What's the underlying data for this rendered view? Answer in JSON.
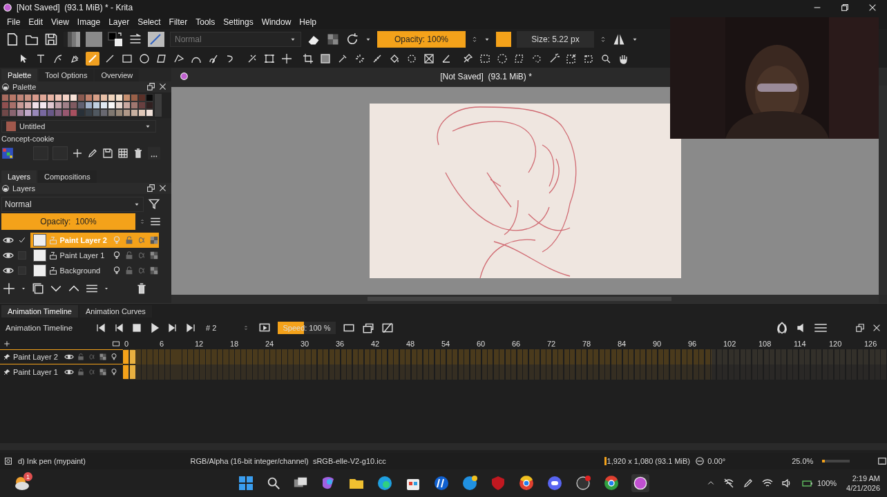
{
  "window": {
    "title": "[Not Saved]  (93.1 MiB) * - Krita"
  },
  "menu": [
    "File",
    "Edit",
    "View",
    "Image",
    "Layer",
    "Select",
    "Filter",
    "Tools",
    "Settings",
    "Window",
    "Help"
  ],
  "toolbar": {
    "blend_mode": "Normal",
    "opacity": {
      "label": "Opacity: 100%",
      "level": 1
    },
    "size": {
      "label": "Size: 5.22 px"
    },
    "foreground": {
      "color": "#f4a21a"
    }
  },
  "tools": [
    {
      "selected": false
    },
    {
      "selected": false
    },
    {
      "selected": false
    },
    {
      "selected": false
    },
    {
      "selected": true
    },
    {
      "selected": false
    },
    {
      "selected": false
    },
    {
      "selected": false
    },
    {
      "selected": false
    },
    {
      "selected": false
    },
    {
      "selected": false
    },
    {
      "selected": false
    },
    {
      "selected": false
    },
    {
      "selected": false
    },
    {
      "selected": false
    },
    {
      "selected": false
    },
    {
      "selected": false
    },
    {
      "selected": false
    },
    {
      "selected": false
    },
    {
      "selected": false
    },
    {
      "selected": false
    },
    {
      "selected": false
    },
    {
      "selected": false
    },
    {
      "selected": false
    },
    {
      "selected": false
    },
    {
      "selected": false
    },
    {
      "selected": false
    },
    {
      "selected": false
    },
    {
      "selected": false
    },
    {
      "selected": false
    },
    {
      "selected": false
    },
    {
      "selected": false
    },
    {
      "selected": false
    },
    {
      "selected": false
    },
    {
      "selected": false
    }
  ],
  "top_dock": {
    "tabs": [
      {
        "label": "Palette",
        "selected": true
      },
      {
        "label": "Tool Options",
        "selected": false
      },
      {
        "label": "Overview",
        "selected": false
      }
    ],
    "title": "Palette",
    "swatches": [
      {
        "color": "#a86a5e"
      },
      {
        "color": "#b87868"
      },
      {
        "color": "#c08578"
      },
      {
        "color": "#c99080"
      },
      {
        "color": "#d89a8c"
      },
      {
        "color": "#e0a898"
      },
      {
        "color": "#e8b4a4"
      },
      {
        "color": "#f0c4b6"
      },
      {
        "color": "#f4d2c6"
      },
      {
        "color": "#f8e2d8"
      },
      {
        "color": "#8a5a50"
      },
      {
        "color": "#c07f6a"
      },
      {
        "color": "#d8a088"
      },
      {
        "color": "#e8c0a8"
      },
      {
        "color": "#f0d4bc"
      },
      {
        "color": "#f4e0cc"
      },
      {
        "color": "#c89070"
      },
      {
        "color": "#9a6048"
      },
      {
        "color": "#5a3028"
      },
      {
        "color": "#0a0a0a"
      },
      {
        "color": "#905050"
      },
      {
        "color": "#a8706a"
      },
      {
        "color": "#c89a96"
      },
      {
        "color": "#d8b0b0"
      },
      {
        "color": "#f0e0e8"
      },
      {
        "color": "#f4e8f0"
      },
      {
        "color": "#e0c8d0"
      },
      {
        "color": "#c0a0a8"
      },
      {
        "color": "#a08088"
      },
      {
        "color": "#805a60"
      },
      {
        "color": "#606070"
      },
      {
        "color": "#a0b0c8"
      },
      {
        "color": "#c0d0e0"
      },
      {
        "color": "#e0e8f0"
      },
      {
        "color": "#f8f8f8"
      },
      {
        "color": "#e8d8d0"
      },
      {
        "color": "#c8a8a0"
      },
      {
        "color": "#a07870"
      },
      {
        "color": "#684040"
      },
      {
        "color": "#302020"
      },
      {
        "color": "#704848"
      },
      {
        "color": "#8a6470"
      },
      {
        "color": "#a888a0"
      },
      {
        "color": "#c0a8c8"
      },
      {
        "color": "#9888b8"
      },
      {
        "color": "#7868a0"
      },
      {
        "color": "#685888"
      },
      {
        "color": "#806080"
      },
      {
        "color": "#985870"
      },
      {
        "color": "#a85060"
      },
      {
        "color": "#283038"
      },
      {
        "color": "#384048"
      },
      {
        "color": "#505860"
      },
      {
        "color": "#686870"
      },
      {
        "color": "#807870"
      },
      {
        "color": "#988878"
      },
      {
        "color": "#b09888"
      },
      {
        "color": "#c8b0a0"
      },
      {
        "color": "#e0c8b8"
      },
      {
        "color": "#f0e0d8"
      }
    ],
    "current_color": {
      "name": "Untitled",
      "color": "#a0584c"
    },
    "palette_name": "Concept-cookie"
  },
  "layers_dock": {
    "tabs": [
      {
        "label": "Layers",
        "selected": true
      },
      {
        "label": "Compositions",
        "selected": false
      }
    ],
    "title": "Layers",
    "blend_mode": "Normal",
    "opacity": {
      "label": "Opacity:  100%",
      "level": 1
    },
    "layers": [
      {
        "name": "Paint Layer 2",
        "selected": true,
        "checked": true,
        "visible": true
      },
      {
        "name": "Paint Layer 1",
        "selected": false,
        "checked": false,
        "visible": true
      },
      {
        "name": "Background",
        "selected": false,
        "checked": false,
        "visible": true
      }
    ]
  },
  "canvas": {
    "title": "[Not Saved]  (93.1 MiB) *"
  },
  "timeline": {
    "tabs": [
      {
        "label": "Animation Timeline",
        "selected": true
      },
      {
        "label": "Animation Curves",
        "selected": false
      }
    ],
    "title": "Animation Timeline",
    "frame": "# 2",
    "speed": {
      "label": "Speed: 100 %",
      "level": 0.45
    },
    "ruler": [
      "0",
      "6",
      "12",
      "18",
      "24",
      "30",
      "36",
      "42",
      "48",
      "54",
      "60",
      "66",
      "72",
      "78",
      "84",
      "90",
      "96",
      "102",
      "108",
      "114",
      "120",
      "126"
    ],
    "layers": [
      {
        "name": "Paint Layer 2",
        "selected": true,
        "frames": [
          {
            "key": true,
            "selected": false
          },
          {
            "key": true,
            "selected": true
          }
        ]
      },
      {
        "name": "Paint Layer 1",
        "selected": false,
        "frames": [
          {
            "key": true,
            "selected": false
          },
          {
            "key": true,
            "selected": true
          }
        ]
      }
    ]
  },
  "status_bar": {
    "brush": "d) Ink pen (mypaint)",
    "color_space": "RGB/Alpha (16-bit integer/channel)  sRGB-elle-V2-g10.icc",
    "image_size": "1,920 x 1,080 (93.1 MiB)",
    "rotation": "0.00°",
    "zoom": "25.0%",
    "zoom_slider": {
      "level": 0.1
    }
  },
  "taskbar": {
    "weather_badge": "1",
    "battery": "100%",
    "time": "2:19 AM",
    "date": "4/21/2026"
  }
}
